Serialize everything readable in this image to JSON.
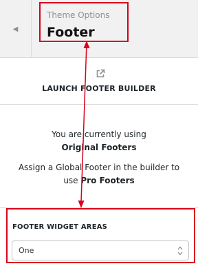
{
  "header": {
    "back_icon": "chevron-left-icon",
    "subtitle": "Theme Options",
    "title": "Footer"
  },
  "builder": {
    "icon": "external-link-icon",
    "label": "LAUNCH FOOTER BUILDER"
  },
  "info": {
    "line1": "You are currently using",
    "line1_bold": "Original Footers",
    "line2": "Assign a Global Footer in the builder to",
    "line3_prefix": "use",
    "line3_bold": "Pro Footers"
  },
  "widget_areas": {
    "label": "FOOTER WIDGET AREAS",
    "value": "One"
  },
  "colors": {
    "highlight": "#d9001b",
    "header_bg": "#f1f1f1",
    "border": "#dcdcde",
    "muted": "#8c8f94"
  }
}
